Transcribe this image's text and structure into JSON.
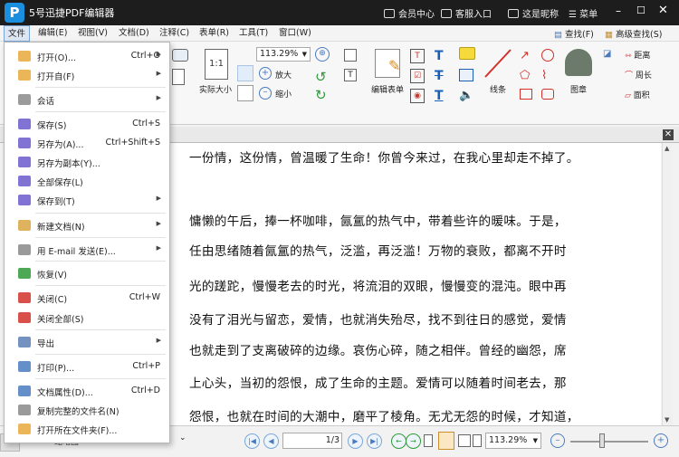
{
  "app": {
    "logo_letter": "P",
    "title": "5号迅捷PDF编辑器"
  },
  "titlebar_links": [
    "会员中心",
    "客服入口",
    "这是昵称",
    "菜单"
  ],
  "menus": [
    "文件",
    "编辑(E)",
    "视图(V)",
    "文档(D)",
    "注释(C)",
    "表单(R)",
    "工具(T)",
    "窗口(W)"
  ],
  "toolbar": {
    "actual_size": "实际大小",
    "zoom_value": "113.29%",
    "zoom_in": "放大",
    "zoom_out": "缩小",
    "edit_form": "编辑表单",
    "lines": "线条",
    "stamp": "图章",
    "distance": "距离",
    "perimeter": "周长",
    "area": "面积",
    "find": "查找(F)",
    "advanced_find": "高级查找(S)"
  },
  "file_menu": [
    {
      "label": "打开(O)...",
      "shortcut": "Ctrl+O",
      "arrow": true
    },
    {
      "label": "打开自(F)",
      "shortcut": "",
      "arrow": true
    },
    {
      "label": "会话",
      "shortcut": "",
      "arrow": true
    },
    {
      "label": "保存(S)",
      "shortcut": "Ctrl+S",
      "arrow": false
    },
    {
      "label": "另存为(A)...",
      "shortcut": "Ctrl+Shift+S",
      "arrow": false
    },
    {
      "label": "另存为副本(Y)...",
      "shortcut": "",
      "arrow": false
    },
    {
      "label": "全部保存(L)",
      "shortcut": "",
      "arrow": false
    },
    {
      "label": "保存到(T)",
      "shortcut": "",
      "arrow": true
    },
    {
      "label": "新建文档(N)",
      "shortcut": "",
      "arrow": true
    },
    {
      "label": "用 E-mail 发送(E)...",
      "shortcut": "",
      "arrow": true
    },
    {
      "label": "恢复(V)",
      "shortcut": "",
      "arrow": false
    },
    {
      "label": "关闭(C)",
      "shortcut": "Ctrl+W",
      "arrow": false
    },
    {
      "label": "关闭全部(S)",
      "shortcut": "",
      "arrow": false
    },
    {
      "label": "导出",
      "shortcut": "",
      "arrow": true
    },
    {
      "label": "打印(P)...",
      "shortcut": "Ctrl+P",
      "arrow": false
    },
    {
      "label": "文档属性(D)...",
      "shortcut": "Ctrl+D",
      "arrow": false
    },
    {
      "label": "复制完整的文件名(N)",
      "shortcut": "",
      "arrow": false
    },
    {
      "label": "打开所在文件夹(F)...",
      "shortcut": "",
      "arrow": false
    }
  ],
  "document": {
    "lines": [
      "一份情，这份情，曾温暖了生命！你曾今来过，在我心里却走不掉了。",
      "",
      "慵懒的午后，捧一杯咖啡，氤氲的热气中，带着些许的暖味。于是，",
      "任由思绪随着氤氲的热气，泛滥，再泛滥！万物的衰败，都离不开时",
      "光的蹉跎，慢慢老去的时光，将流泪的双眼，慢慢变的混沌。眼中再",
      "没有了泪光与留恋，爱情，也就消失殆尽，找不到往日的感觉，爱情",
      "也就走到了支离破碎的边缘。哀伤心碎，随之相伴。曾经的幽怨，席",
      "上心头，当初的怨恨，成了生命的主题。爱情可以随着时间老去，那",
      "怨恨，也就在时间的大潮中，磨平了棱角。无尤无怨的时候，才知道，"
    ]
  },
  "statusbar": {
    "page_current": "1",
    "page_total": "/3",
    "zoom": "113.29%",
    "left_tab": "缩略图"
  },
  "colors": {
    "titlebar": "#1d1d1d",
    "logo": "#1a8fe0",
    "accent": "#4a7bc0"
  }
}
